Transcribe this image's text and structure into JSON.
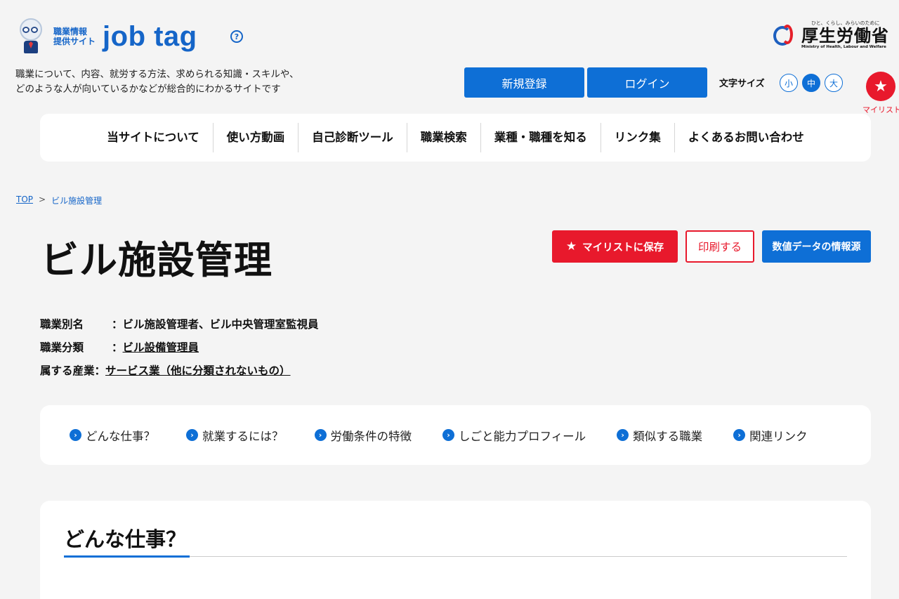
{
  "header": {
    "logo_sub_line1": "職業情報",
    "logo_sub_line2": "提供サイト",
    "logo_main": "job tag",
    "help_symbol": "?",
    "tagline_line1": "職業について、内容、就労する方法、求められる知識・スキルや、",
    "tagline_line2": "どのような人が向いているかなどが総合的にわかるサイトです",
    "ministry_tag": "ひと、くらし、みらいのために",
    "ministry_name": "厚生労働省",
    "ministry_en": "Ministry of Health, Labour and Welfare",
    "register_label": "新規登録",
    "login_label": "ログイン",
    "font_size_label": "文字サイズ",
    "font_sizes": [
      "小",
      "中",
      "大"
    ],
    "mylist_label": "マイリスト"
  },
  "nav": {
    "items": [
      "当サイトについて",
      "使い方動画",
      "自己診断ツール",
      "職業検索",
      "業種・職種を知る",
      "リンク集",
      "よくあるお問い合わせ"
    ]
  },
  "breadcrumb": {
    "top": "TOP",
    "separator": ">",
    "current": "ビル施設管理"
  },
  "page": {
    "title": "ビル施設管理",
    "save_label": "マイリストに保存",
    "print_label": "印刷する",
    "source_label": "数値データの情報源"
  },
  "meta": {
    "alias_key": "職業別名",
    "alias_value": "：ビル施設管理者、ビル中央管理室監視員",
    "category_key": "職業分類",
    "category_colon": "：",
    "category_value": "ビル設備管理員",
    "industry_key": "属する産業",
    "industry_colon": "：",
    "industry_value": "サービス業（他に分類されないもの）"
  },
  "section_nav": {
    "items": [
      "どんな仕事？",
      "就業するには？",
      "労働条件の特徴",
      "しごと能力プロフィール",
      "類似する職業",
      "関連リンク"
    ]
  },
  "content": {
    "section_title": "どんな仕事？"
  },
  "colors": {
    "brand_blue": "#0e6fd6",
    "accent_red": "#e8192c"
  },
  "icons": {
    "help": "help-icon",
    "mylist": "star-icon",
    "section_nav": "chevron-right-circle-icon"
  }
}
